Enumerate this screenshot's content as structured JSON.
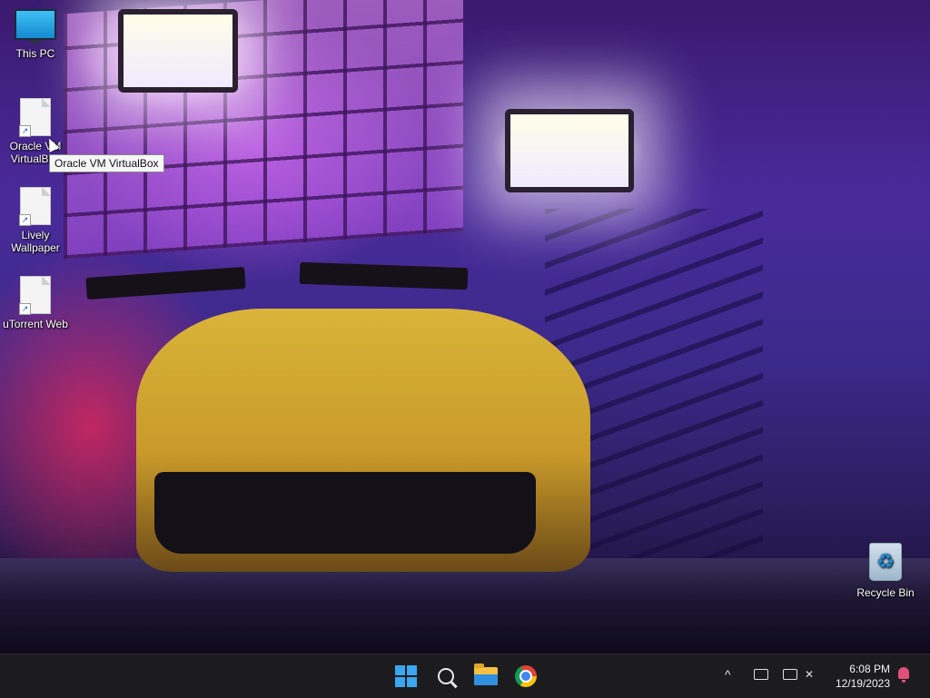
{
  "desktop": {
    "icons": [
      {
        "label": "This PC",
        "icon": "monitor-icon"
      },
      {
        "label": "Oracle VM VirtualBox",
        "icon": "file-shortcut-icon"
      },
      {
        "label": "Lively Wallpaper",
        "icon": "file-shortcut-icon"
      },
      {
        "label": "uTorrent Web",
        "icon": "file-shortcut-icon"
      },
      {
        "label": "Recycle Bin",
        "icon": "recycle-bin-icon"
      }
    ],
    "tooltip": "Oracle VM VirtualBox"
  },
  "taskbar": {
    "apps": [
      {
        "name": "Start",
        "icon": "windows-logo-icon"
      },
      {
        "name": "Search",
        "icon": "search-icon"
      },
      {
        "name": "File Explorer",
        "icon": "folder-icon"
      },
      {
        "name": "Google Chrome",
        "icon": "chrome-icon"
      }
    ],
    "tray": {
      "chevron": "^",
      "time": "6:08 PM",
      "date": "12/19/2023"
    }
  },
  "colors": {
    "taskbar_bg": "#1c1c1f",
    "windows_accent": "#3aa7f0",
    "notification_bell": "#e0507a"
  }
}
